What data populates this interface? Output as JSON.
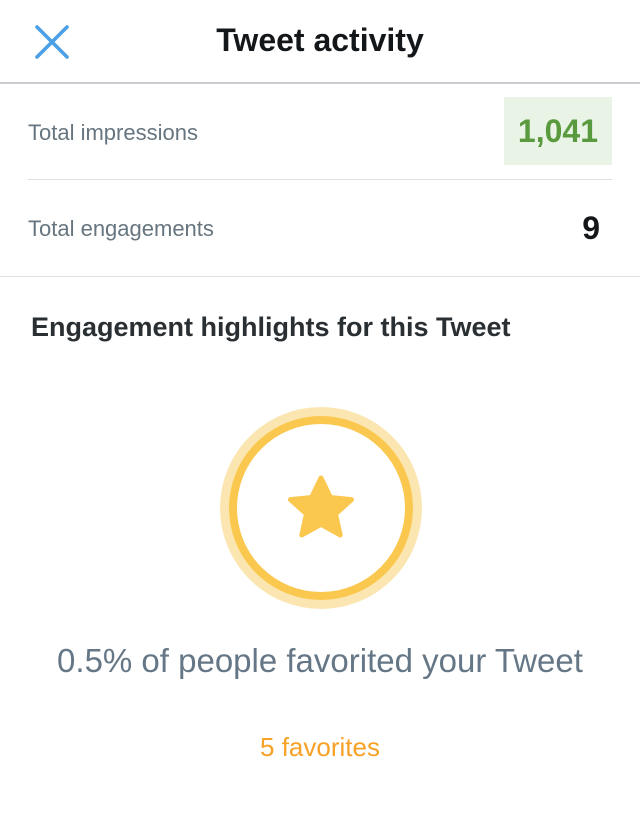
{
  "header": {
    "title": "Tweet activity",
    "close_icon": "close-icon"
  },
  "stats": {
    "impressions_label": "Total impressions",
    "impressions_value": "1,041",
    "engagements_label": "Total engagements",
    "engagements_value": "9"
  },
  "highlights": {
    "title": "Engagement highlights for this Tweet",
    "badge_icon": "star-icon",
    "text": "0.5% of people favorited your Tweet",
    "subtext": "5 favorites"
  },
  "colors": {
    "close_icon": "#4a9fe5",
    "impressions_bg": "#e9f3e6",
    "impressions_text": "#5a9a3e",
    "star": "#fbc84f",
    "favorites_text": "#f7a127"
  }
}
